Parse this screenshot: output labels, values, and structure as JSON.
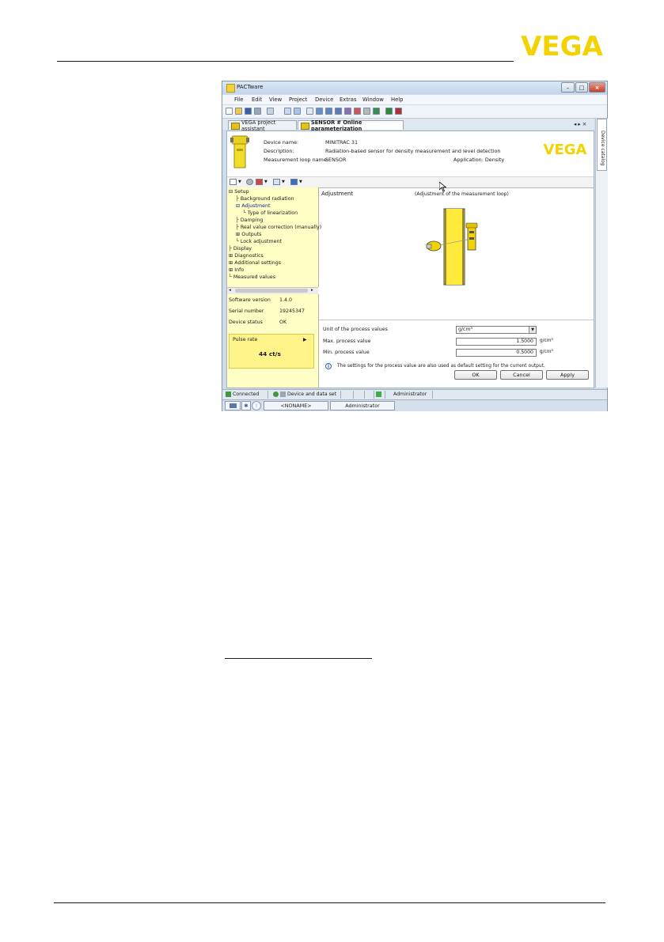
{
  "window": {
    "title": "PACTware",
    "minimize_glyph": "–",
    "maximize_glyph": "□",
    "close_glyph": "×"
  },
  "menu": [
    "File",
    "Edit",
    "View",
    "Project",
    "Device",
    "Extras",
    "Window",
    "Help"
  ],
  "tabs": [
    {
      "label": "VEGA project assistant",
      "active": false
    },
    {
      "label": "SENSOR # Online parameterization",
      "active": true
    }
  ],
  "tab_nav": "◂ ▸ ×",
  "side_tab": "Device catalog",
  "device": {
    "name_label": "Device name:",
    "name_value": "MINITRAC 31",
    "description_label": "Description:",
    "description_value": "Radiation-based sensor for density measurement and level detection",
    "loop_label": "Measurement loop name:",
    "loop_value": "SENSOR",
    "application": "Application: Density"
  },
  "brand": {
    "logo_text": "VEGA",
    "color": "#f2d200"
  },
  "tree": [
    {
      "label": "Setup",
      "prefix": "⊟",
      "indent": 0
    },
    {
      "label": "Background radiation",
      "prefix": "├",
      "indent": 1
    },
    {
      "label": "Adjustment",
      "prefix": "⊟",
      "indent": 1,
      "selected": true
    },
    {
      "label": "Type of linearization",
      "prefix": "└",
      "indent": 2
    },
    {
      "label": "Damping",
      "prefix": "├",
      "indent": 1
    },
    {
      "label": "Real value correction (manually)",
      "prefix": "├",
      "indent": 1
    },
    {
      "label": "Outputs",
      "prefix": "⊞",
      "indent": 1
    },
    {
      "label": "Lock adjustment",
      "prefix": "└",
      "indent": 1
    },
    {
      "label": "Display",
      "prefix": "├",
      "indent": 0
    },
    {
      "label": "Diagnostics",
      "prefix": "⊞",
      "indent": 0
    },
    {
      "label": "Additional settings",
      "prefix": "⊞",
      "indent": 0
    },
    {
      "label": "Info",
      "prefix": "⊞",
      "indent": 0
    },
    {
      "label": "Measured values",
      "prefix": "└",
      "indent": 0
    }
  ],
  "scroll": {
    "left": "◂",
    "right": "▸"
  },
  "info": {
    "software_label": "Software version",
    "software_value": "1.4.0",
    "serial_label": "Serial number",
    "serial_value": "19245347",
    "status_label": "Device status",
    "status_value": "OK",
    "pulse_label": "Pulse rate",
    "pulse_arrow": "▶",
    "pulse_value": "44 ct/s"
  },
  "adjustment": {
    "title": "Adjustment",
    "subtitle": "(Adjustment of the measurement loop)"
  },
  "form": {
    "unit_label": "Unit of the process values",
    "unit_value": "g/cm³",
    "max_label": "Max. process value",
    "max_value": "1.5000",
    "max_unit": "g/cm³",
    "min_label": "Min. process value",
    "min_value": "0.5000",
    "min_unit": "g/cm³",
    "note": "The settings for the process value are also used as default setting for the current output.",
    "dropdown_arrow": "▼"
  },
  "buttons": {
    "ok": "OK",
    "cancel": "Cancel",
    "apply": "Apply"
  },
  "status": {
    "connected": "Connected",
    "dataset": "Device and data set",
    "user": "Administrator"
  },
  "taskbar": {
    "project": "<NONAME>",
    "user": "Administrator",
    "star": "✱",
    "info_glyph": "i"
  },
  "info_icon_glyph": "i"
}
